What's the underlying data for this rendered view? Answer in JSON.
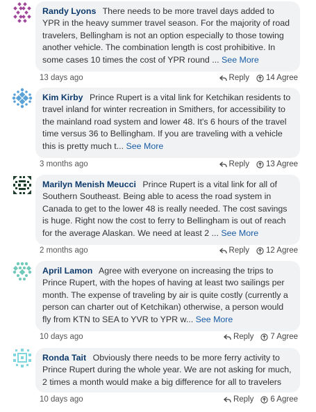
{
  "comments": [
    {
      "author": "Randy Lyons",
      "text": "There needs to be more travel days added to YPR in the heavy summer travel season. For the majority of road travelers, Bellingham is not an option especially to those towing another vehicle. The combination length is cost prohibitive. In some cases 10 times the cost of YPR round ...",
      "see_more": "See More",
      "time": "13 days ago",
      "reply": "Reply",
      "votes": "14 Agree",
      "avatar_color": "#a0479a",
      "avatar_icon": "geometric-avatar-icon"
    },
    {
      "author": "Kim Kirby",
      "text": "Prince Rupert is a vital link for Ketchikan residents to travel inland for winter recreation in Smithers, for accessibility to the mainland road system and lower 48. It's 6 hours of the travel time versus 36 to Bellingham. If you are traveling with a vehicle this is pretty much t...",
      "see_more": "See More",
      "time": "3 months ago",
      "reply": "Reply",
      "votes": "13 Agree",
      "avatar_color": "#5aa1d8",
      "avatar_icon": "geometric-avatar-icon"
    },
    {
      "author": "Marilyn Menish Meucci",
      "text": "Prince Rupert is a vital link for all of Southern Southeast. Being able to acess the road system in Canada to get to the lower 48 is really needed. The cost savings is huge. Right now the cost to ferry to Bellingham is out of reach for the average Alaskan. We need at least 2 ...",
      "see_more": "See More",
      "time": "2 months ago",
      "reply": "Reply",
      "votes": "12 Agree",
      "avatar_color": "#1f3d2c",
      "avatar_icon": "geometric-avatar-icon"
    },
    {
      "author": "April Lamon",
      "text": "Agree with everyone on increasing the trips to Prince Rupert, with the hopes of having at least two sailings per month. The expense of traveling by air is quite costly (currently a person can charter out of Ketchikan) otherwise, a person would fly from KTN to SEA to YVR to YPR w...",
      "see_more": "See More",
      "time": "10 days ago",
      "reply": "Reply",
      "votes": "7 Agree",
      "avatar_color": "#6fc9b8",
      "avatar_icon": "geometric-avatar-icon"
    },
    {
      "author": "Ronda Tait",
      "text": "Obviously there needs to be more ferry activity to Prince Rupert during the whole year. We are not asking for much, 2 times a month would make a big difference for all to travelers",
      "see_more": "",
      "time": "10 days ago",
      "reply": "Reply",
      "votes": "6 Agree",
      "avatar_color": "#7fd6dc",
      "avatar_icon": "geometric-avatar-icon"
    }
  ]
}
